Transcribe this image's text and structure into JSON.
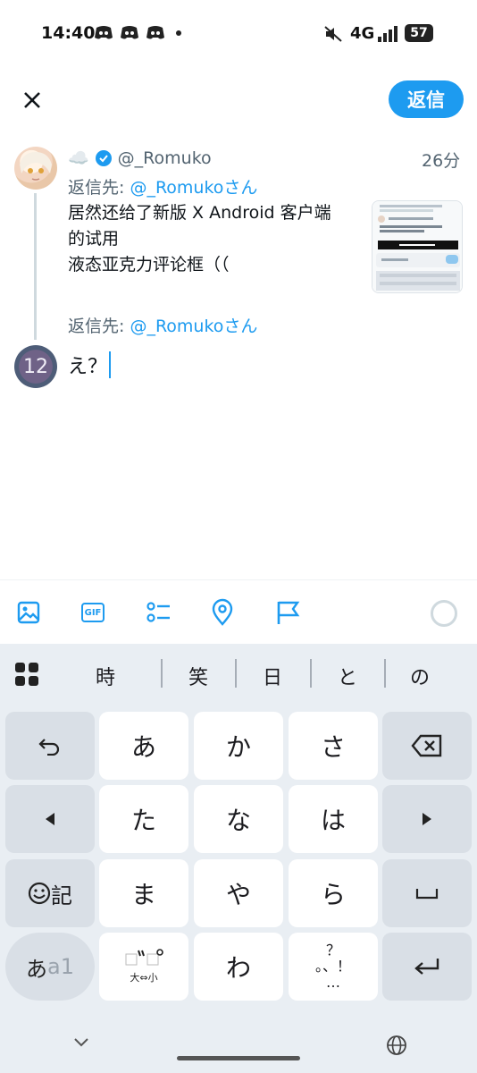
{
  "status_bar": {
    "time": "14:40",
    "network": "4G",
    "battery": "57"
  },
  "header": {
    "close_icon": "close-icon",
    "reply_button_label": "返信"
  },
  "original_tweet": {
    "display_name": "☁️",
    "handle": "@_Romuko",
    "time_ago": "26分",
    "reply_to_prefix": "返信先: ",
    "reply_to_handle": "@_Romukoさん",
    "text_lines": [
      "居然还给了新版 X Android 客户端",
      "的试用",
      "液态亚克力评论框（（"
    ]
  },
  "compose": {
    "reply_to_prefix": "返信先: ",
    "reply_to_handle": "@_Romukoさん",
    "avatar_text": "12",
    "draft_text": "え？"
  },
  "toolbar": {
    "icons": [
      "image-icon",
      "gif-icon",
      "poll-icon",
      "location-icon",
      "flag-icon"
    ],
    "gif_label": "GIF"
  },
  "keyboard": {
    "suggestions": [
      "時",
      "笑",
      "日",
      "と",
      "の"
    ],
    "rows": [
      [
        "あ",
        "か",
        "さ"
      ],
      [
        "た",
        "な",
        "は"
      ],
      [
        "ま",
        "や",
        "ら"
      ],
      [
        "",
        "わ",
        ""
      ]
    ],
    "emoji_key_label": "記",
    "mode_key_label": "あ",
    "mode_key_alt": "a1",
    "dakuten_key_sub": "大⇔小",
    "punct_key": "？",
    "punct_key_bottom": "。、！",
    "punct_key_dots": "…"
  },
  "colors": {
    "accent": "#1d9bf0",
    "keyboard_bg": "#e9eef3"
  }
}
